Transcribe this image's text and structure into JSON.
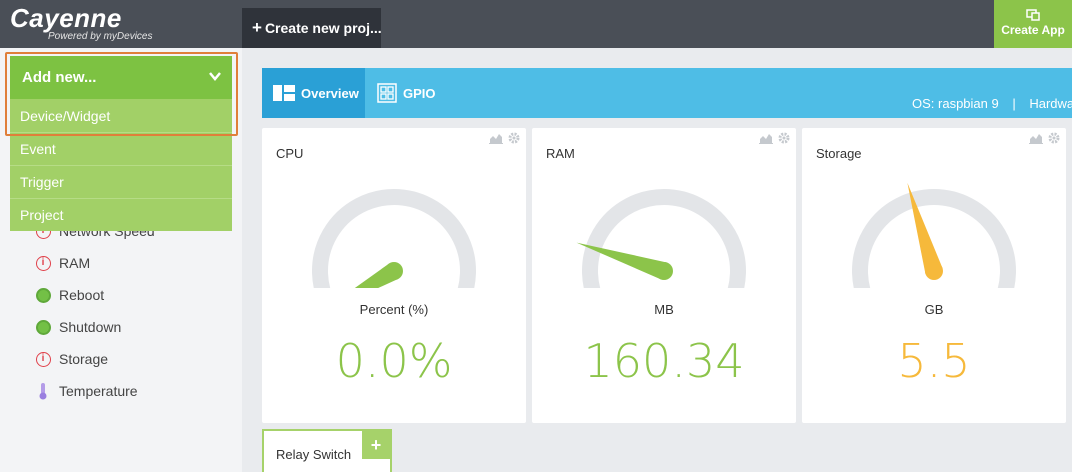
{
  "app": {
    "name": "Cayenne",
    "tagline": "Powered by myDevices"
  },
  "topbar": {
    "create_project_plus": "+",
    "create_project_label": "Create new proj...",
    "create_app_label": "Create App"
  },
  "dropdown": {
    "header": "Add new...",
    "items": [
      "Device/Widget",
      "Event",
      "Trigger",
      "Project"
    ]
  },
  "sidebar": {
    "items": [
      {
        "label": "Network Speed",
        "status": "warning"
      },
      {
        "label": "RAM",
        "status": "warning"
      },
      {
        "label": "Reboot",
        "status": "ok"
      },
      {
        "label": "Shutdown",
        "status": "ok"
      },
      {
        "label": "Storage",
        "status": "warning"
      },
      {
        "label": "Temperature",
        "status": "thermometer"
      }
    ]
  },
  "tabs": {
    "overview": "Overview",
    "gpio": "GPIO"
  },
  "device_info": {
    "os": "OS: raspbian 9",
    "separator": "|",
    "hardware": "Hardwa"
  },
  "widgets": [
    {
      "title": "CPU",
      "unit": "Percent (%)",
      "value": "0.0%",
      "gauge_level": 0.0,
      "color": "#8cc44a"
    },
    {
      "title": "RAM",
      "unit": "MB",
      "value": "160.34",
      "gauge_level": 0.2,
      "color": "#8cc44a"
    },
    {
      "title": "Storage",
      "unit": "GB",
      "value": "5.5",
      "gauge_level": 0.43,
      "color": "#f6b93b"
    }
  ],
  "relay": {
    "title": "Relay Switch",
    "add": "+"
  },
  "colors": {
    "brand_green": "#7dc242",
    "tab_blue": "#4ebde6",
    "topbar": "#4a4f57",
    "warning_red": "#e0404a",
    "highlight_orange": "#e07f3a"
  }
}
